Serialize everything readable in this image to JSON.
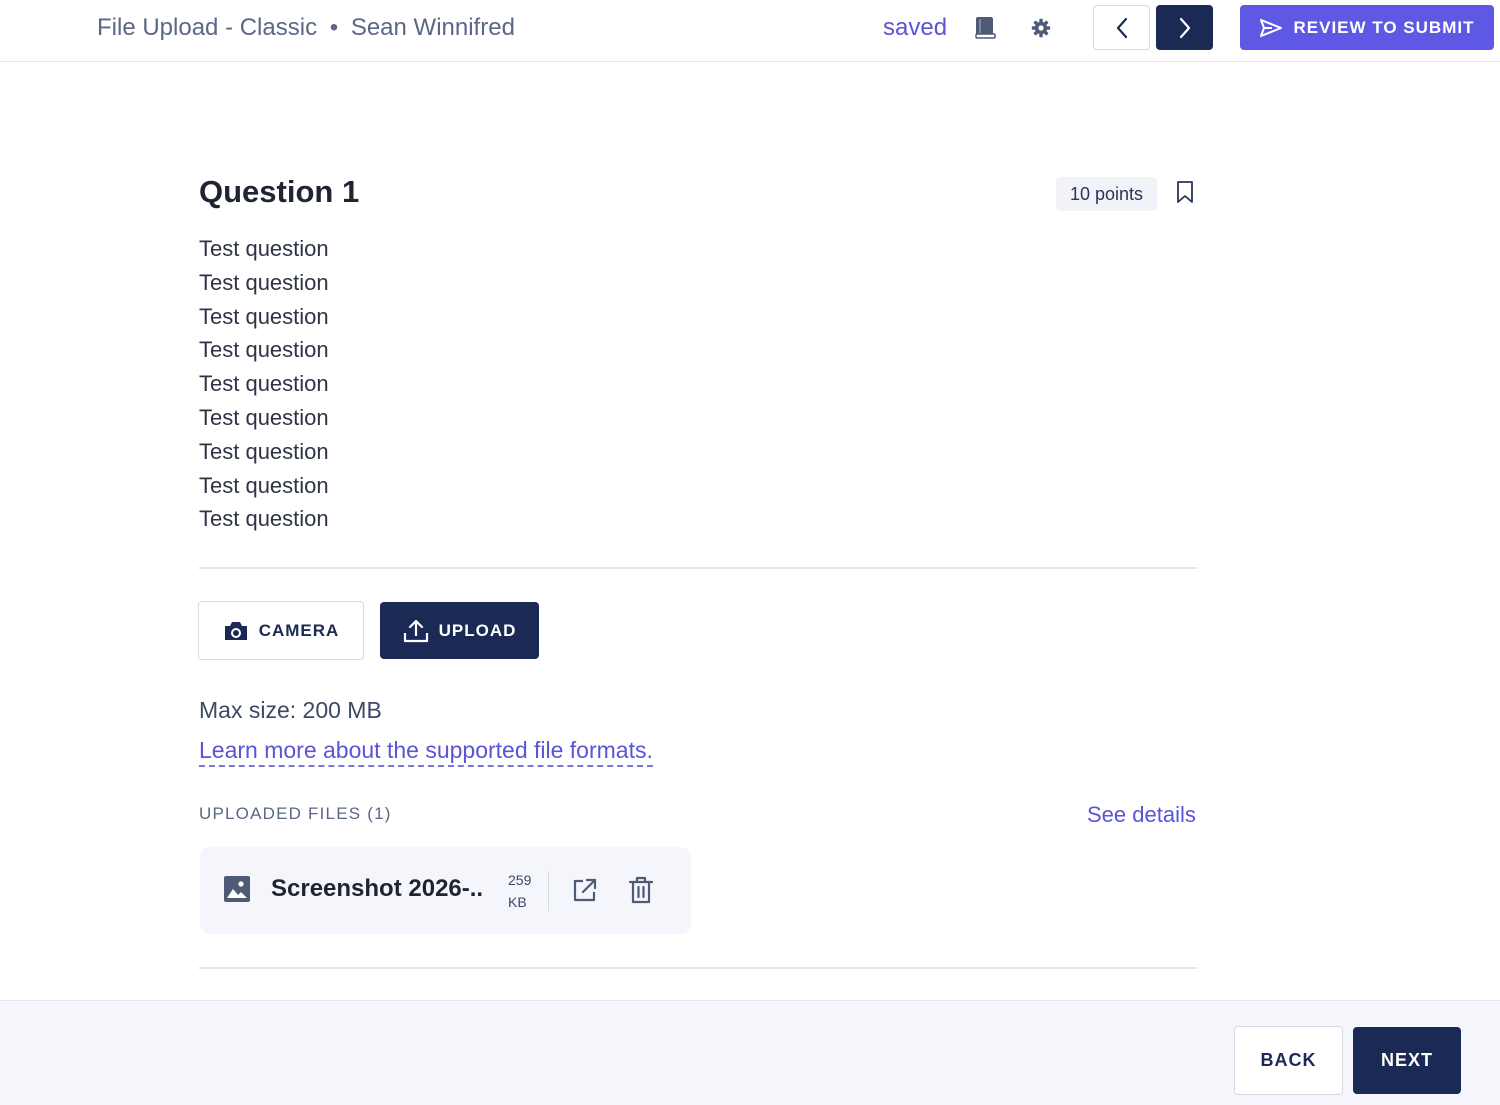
{
  "header": {
    "assignment_title": "File Upload - Classic",
    "separator": "•",
    "student_name": "Sean Winnifred",
    "save_status": "saved",
    "review_label": "REVIEW TO SUBMIT",
    "icons": [
      "book-icon",
      "gear-icon",
      "chevron-left-icon",
      "chevron-right-icon",
      "send-icon"
    ]
  },
  "question": {
    "title": "Question 1",
    "points": "10 points",
    "lines": [
      "Test question",
      "Test question",
      "Test question",
      "Test question",
      "Test question",
      "Test question",
      "Test question",
      "Test question",
      "Test question"
    ]
  },
  "upload": {
    "camera_label": "CAMERA",
    "upload_label": "UPLOAD",
    "max_size": "Max size: 200 MB",
    "learn_more": "Learn more about the supported file formats.",
    "uploaded_files_label": "UPLOADED FILES (1)",
    "see_details": "See details",
    "files": [
      {
        "name": "Screenshot 2026-..",
        "size_value": "259",
        "size_unit": "KB"
      }
    ]
  },
  "footer": {
    "back_label": "BACK",
    "next_label": "NEXT"
  },
  "colors": {
    "accent": "#5e58e4",
    "navy": "#1b2a55",
    "link": "#5b54d6"
  }
}
